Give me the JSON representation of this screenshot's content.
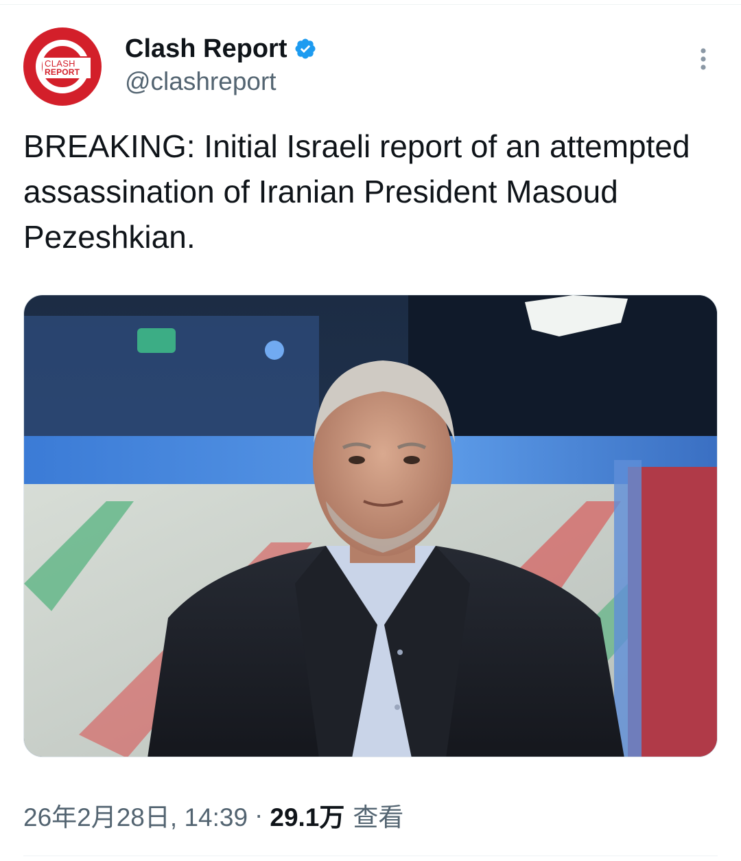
{
  "tweet": {
    "author": {
      "display_name": "Clash Report",
      "handle": "@clashreport",
      "verified": true,
      "avatar_text_line1": "CLASH",
      "avatar_text_line2": "REPORT",
      "avatar_color": "#d31f2a"
    },
    "text": "BREAKING: Initial Israeli report of an attempted assassination of Iranian President Masoud Pezeshkian.",
    "media": {
      "icon": "photo"
    },
    "footer": {
      "timestamp": "26年2月28日, 14:39",
      "separator": "·",
      "views_count": "29.1万",
      "views_label": "查看"
    }
  },
  "colors": {
    "verified_blue": "#1d9bf0",
    "secondary_text": "#536471",
    "primary_text": "#0f1419"
  },
  "icons": {
    "more": "more-vertical-icon",
    "verified": "verified-badge-icon"
  }
}
